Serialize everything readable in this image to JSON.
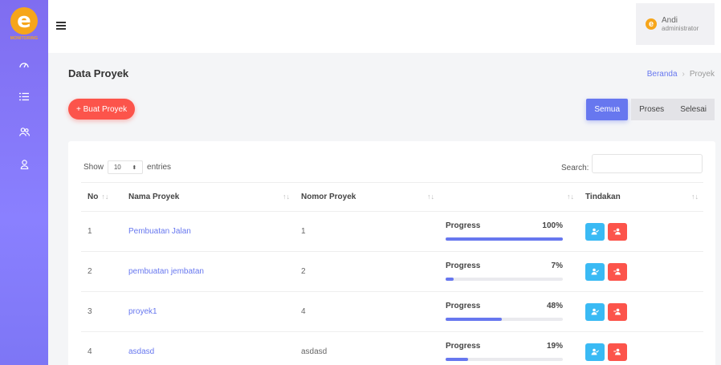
{
  "brand": {
    "logo_letter": "e",
    "logo_text": "MONITORING",
    "accent": "#6777ef",
    "logo_color": "#f6a51a"
  },
  "sidebar": {
    "items": [
      {
        "icon": "dashboard-icon"
      },
      {
        "icon": "list-icon"
      },
      {
        "icon": "users-icon"
      },
      {
        "icon": "user-icon"
      }
    ]
  },
  "topbar": {
    "user_name": "Andi",
    "user_role": "administrator"
  },
  "header": {
    "title": "Data Proyek",
    "breadcrumb": [
      "Beranda",
      "Proyek"
    ]
  },
  "toolbar": {
    "create_label": "+ Buat Proyek",
    "filters": [
      "Semua",
      "Proses",
      "Selesai"
    ],
    "active_filter": "Semua"
  },
  "table_controls": {
    "show": "Show",
    "entries_value": "10",
    "entries": "entries",
    "search_label": "Search:"
  },
  "table": {
    "columns": [
      "No",
      "Nama Proyek",
      "Nomor Proyek",
      "",
      "Tindakan"
    ],
    "progress_label": "Progress",
    "rows": [
      {
        "no": "1",
        "name": "Pembuatan Jalan",
        "number": "1",
        "progress": "100%",
        "progress_value": 100
      },
      {
        "no": "2",
        "name": "pembuatan jembatan",
        "number": "2",
        "progress": "7%",
        "progress_value": 7
      },
      {
        "no": "3",
        "name": "proyek1",
        "number": "4",
        "progress": "48%",
        "progress_value": 48
      },
      {
        "no": "4",
        "name": "asdasd",
        "number": "asdasd",
        "progress": "19%",
        "progress_value": 19
      }
    ]
  }
}
